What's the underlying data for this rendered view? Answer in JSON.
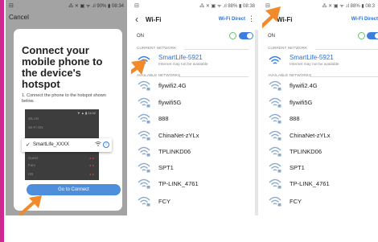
{
  "colors": {
    "side_bar": "#cc2a8e",
    "accent_blue": "#2a6fd6",
    "button_blue": "#4d8fdc",
    "arrow_orange": "#f08a2b",
    "toggle_blue": "#3b7fde"
  },
  "phone1": {
    "status_left": "⊟",
    "status_right": "⁂ ✕ ▣ ᯤ .ıl 90% ▮ 08:34",
    "cancel_label": "Cancel",
    "title": "Connect your mobile phone to the device's hotspot",
    "instruction": "1. Connect the phone to the hotspot shown below.",
    "mini_status": "▼ ▲ ▮ 11:02",
    "mini_rows": [
      "WLAN",
      "Wi-Fi ON",
      "Guest",
      "Fam"
    ],
    "mini_row5": "HB",
    "mini_dots": "● ●",
    "highlight_check": "✓",
    "highlight_network": "SmartLife_XXXX",
    "highlight_wifi_icon": "wifi-icon",
    "info_glyph": "i",
    "button_label": "Go to Connect"
  },
  "wifi_screen": {
    "title": "Wi-Fi",
    "wifi_direct": "Wi-Fi Direct",
    "more": "⋮",
    "on_label": "ON",
    "current_section": "CURRENT NETWORK",
    "available_section": "AVAILABLE NETWORKS",
    "current_network": "SmartLife-5921",
    "current_status": "Internet may not be available",
    "networks": [
      "flywifi2.4G",
      "flywifi5G",
      "888",
      "ChinaNet-zYLx",
      "TPLINKD06",
      "SPT1",
      "TP-LINK_4761",
      "FCY"
    ]
  },
  "phone2": {
    "status_left": "⊟",
    "status_right": "⁂ ✕ ▣ ᯤ .ıl 88% ▮ 08:38"
  },
  "phone3": {
    "status_left": "⊟",
    "status_right": "⁂ ✕ ▣ ᯤ .ıl 88% ▮ 08:3"
  }
}
